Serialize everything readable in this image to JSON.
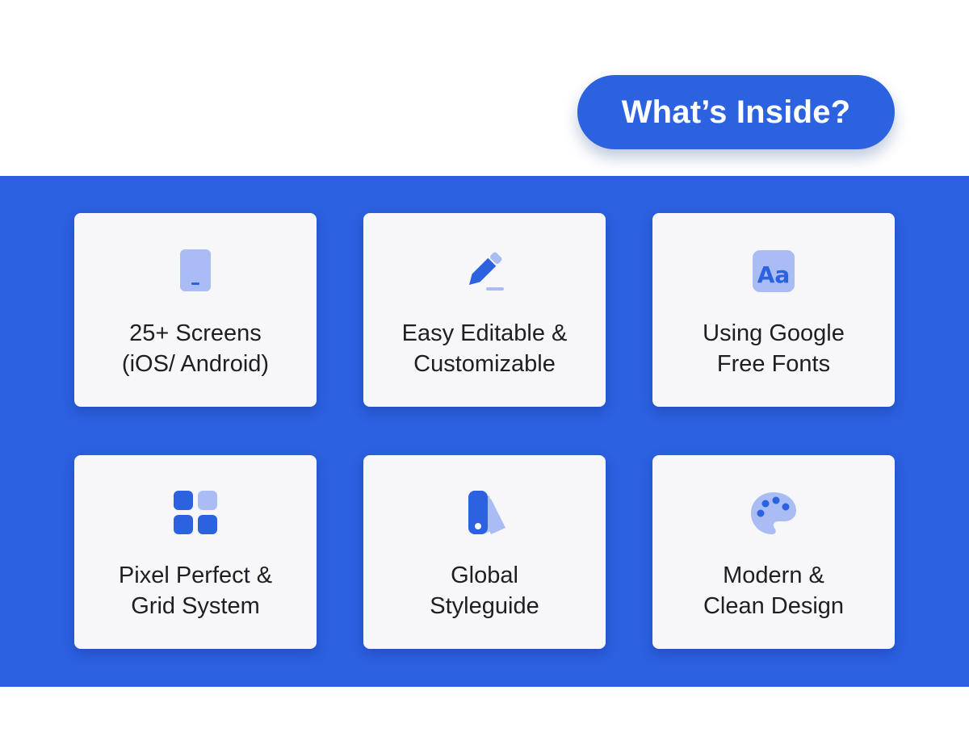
{
  "header": {
    "title": "What’s Inside?"
  },
  "colors": {
    "accent": "#2b60e0",
    "icon_dark": "#2c62e0",
    "icon_light": "#a9bdf4",
    "card_bg": "#f7f7f9"
  },
  "features": [
    {
      "icon": "mobile-phone-icon",
      "line1": "25+ Screens",
      "line2": "(iOS/ Android)"
    },
    {
      "icon": "pencil-edit-icon",
      "line1": "Easy Editable &",
      "line2": "Customizable"
    },
    {
      "icon": "font-aa-icon",
      "line1": "Using Google",
      "line2": "Free Fonts",
      "icon_text": "Aa"
    },
    {
      "icon": "grid-icon",
      "line1": "Pixel Perfect &",
      "line2": "Grid System"
    },
    {
      "icon": "color-swatch-icon",
      "line1": "Global",
      "line2": "Styleguide"
    },
    {
      "icon": "palette-icon",
      "line1": "Modern &",
      "line2": "Clean Design"
    }
  ]
}
